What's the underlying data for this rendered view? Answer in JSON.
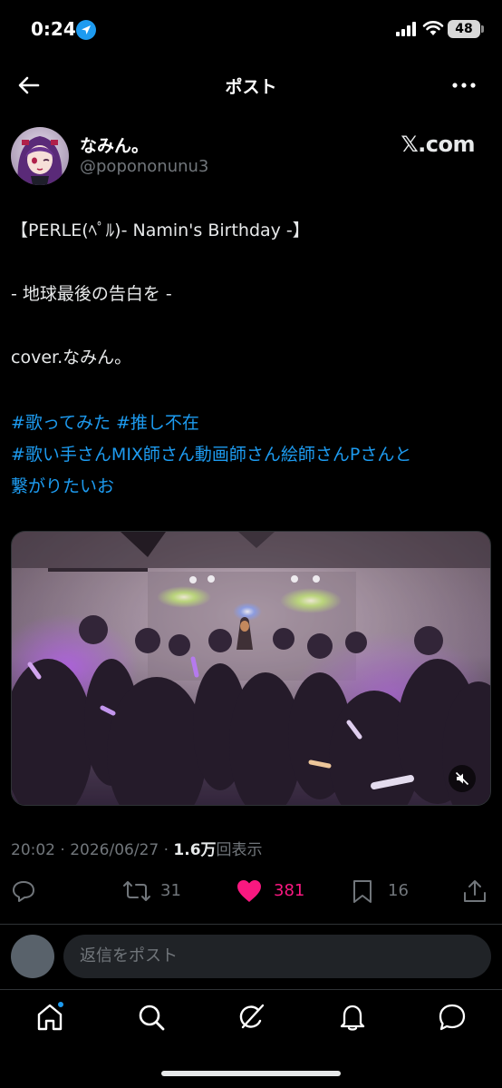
{
  "status_bar": {
    "time": "0:24",
    "battery": "48"
  },
  "nav": {
    "title": "ポスト"
  },
  "author": {
    "name": "なみん。",
    "handle": "@popononunu3",
    "source_badge": "𝕏.com"
  },
  "post": {
    "lines": [
      "【PERLE(ﾍﾟﾙ)- Namin's Birthday -】",
      "-  地球最後の告白を -",
      "cover.なみん。"
    ],
    "hashtag_lines": [
      "#歌ってみた #推し不在",
      "#歌い手さんMIX師さん動画師さん絵師さんPさんと",
      "繋がりたいお"
    ],
    "time": "20:02",
    "date": "2026/06/27",
    "separator": "·",
    "views_count": "1.6万",
    "views_label": "回表示"
  },
  "actions": {
    "reply_count": "",
    "repost_count": "31",
    "like_count": "381",
    "bookmark_count": "16"
  },
  "reply": {
    "placeholder": "返信をポスト"
  },
  "icons": [
    "back-arrow-icon",
    "more-icon",
    "location-arrow-icon",
    "signal-icon",
    "wifi-icon",
    "mute-icon",
    "reply-icon",
    "repost-icon",
    "heart-icon",
    "bookmark-icon",
    "share-icon",
    "home-icon",
    "search-icon",
    "grok-icon",
    "bell-icon",
    "message-icon"
  ],
  "colors": {
    "accent": "#1d9bf0",
    "like": "#f91880",
    "background": "#000000",
    "muted_text": "#71767b"
  }
}
